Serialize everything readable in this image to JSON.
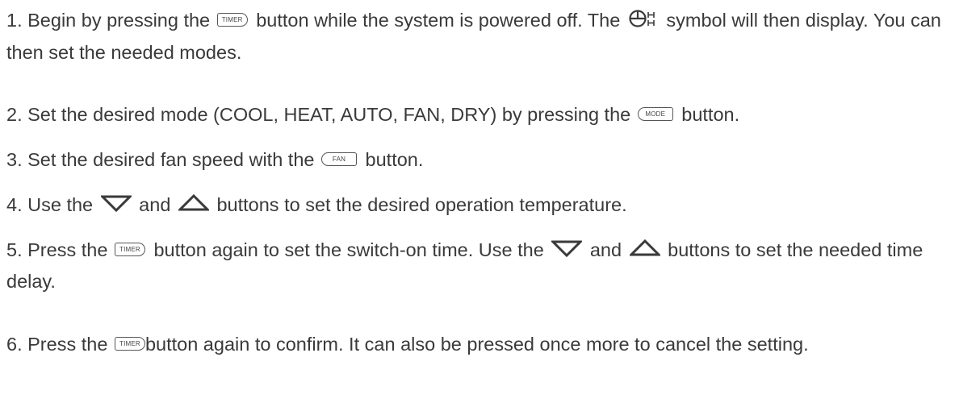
{
  "steps": [
    {
      "id": "step-1",
      "parts": {
        "a": "1. Begin by pressing the ",
        "b": " button while the system is powered off. The ",
        "c": " symbol will then display. You can then set the needed modes."
      }
    },
    {
      "id": "step-2",
      "parts": {
        "a": "2. Set the desired mode (COOL, HEAT, AUTO, FAN, DRY) by pressing the ",
        "b": " button."
      }
    },
    {
      "id": "step-3",
      "parts": {
        "a": "3. Set the desired fan speed with the ",
        "b": " button."
      }
    },
    {
      "id": "step-4",
      "parts": {
        "a": "4. Use the ",
        "b": " and ",
        "c": " buttons to set the desired operation temperature."
      }
    },
    {
      "id": "step-5",
      "parts": {
        "a": "5. Press the ",
        "b": " button again to set the switch-on time. Use the ",
        "c": " and ",
        "d": " buttons to set the needed time delay."
      }
    },
    {
      "id": "step-6",
      "parts": {
        "a": "6. Press the ",
        "b": "button again to confirm. It can also be pressed once more to cancel the setting."
      }
    }
  ],
  "button_labels": {
    "timer": "TIMER",
    "mode": "MODE",
    "fan": "FAN"
  },
  "icons": {
    "timer_button": "timer-button-icon",
    "mode_button": "mode-button-icon",
    "fan_button": "fan-button-icon",
    "down": "down-triangle-icon",
    "up": "up-triangle-icon",
    "clock": "timer-clock-icon"
  },
  "colors": {
    "text": "#3a3a3a",
    "icon_stroke": "#555555"
  }
}
